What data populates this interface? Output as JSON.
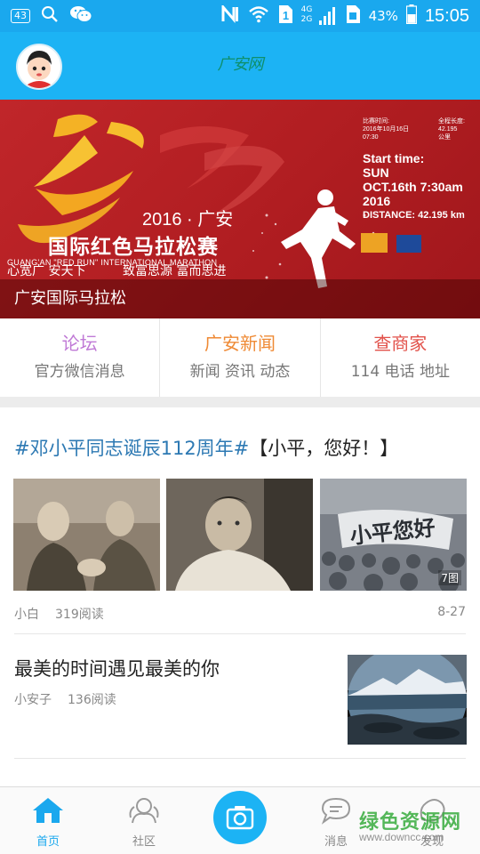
{
  "status_bar": {
    "notification_count": "43",
    "network_4g": "4G",
    "network_2g": "2G",
    "sim_slot": "1",
    "battery_percent": "43%",
    "time": "15:05"
  },
  "header": {
    "logo_text": "广安网"
  },
  "banner": {
    "year_text": "2016 · 广安",
    "title_text": "国际红色马拉松赛",
    "english_text": "GUANG'AN \"RED RUN\" INTERNATIONAL MARATHON",
    "slogan_left": "心宽广 安天下",
    "slogan_right": "致富思源 富而思进",
    "info_date_label": "比赛时间:",
    "info_date_value": "2016年10月16日",
    "info_time_value": "07:30",
    "info_distance_label": "全程长度:",
    "info_distance_value": "42.195",
    "info_distance_unit": "公里",
    "start_label": "Start time:",
    "start_day": "SUN",
    "start_date": "OCT.16th 7:30am",
    "start_year": "2016",
    "distance_text": "DISTANCE: 42.195 km",
    "caption": "广安国际马拉松"
  },
  "categories": [
    {
      "title": "论坛",
      "subtitle": "官方微信消息",
      "color": "#c07ad6"
    },
    {
      "title": "广安新闻",
      "subtitle": "新闻 资讯 动态",
      "color": "#ef8a35"
    },
    {
      "title": "查商家",
      "subtitle": "114 电话 地址",
      "color": "#e2514a"
    }
  ],
  "feed": {
    "post1": {
      "hashtag": "#邓小平同志诞辰112周年#",
      "title": "【小平，您好！】",
      "image_count": "7图",
      "banner_text": "小平您好",
      "author": "小白",
      "reads": "319阅读",
      "date": "8-27"
    },
    "post2": {
      "title": "最美的时间遇见最美的你",
      "author": "小安子",
      "reads": "136阅读"
    }
  },
  "bottom_nav": {
    "home": "首页",
    "community": "社区",
    "messages": "消息",
    "discover": "发现"
  },
  "watermark": {
    "text": "绿色资源网",
    "url": "www.downcc.com"
  },
  "colors": {
    "status_bar": "#1aa8ee",
    "header": "#1cb3f4",
    "banner_red": "#c0262a",
    "hashtag": "#2d79b3"
  }
}
